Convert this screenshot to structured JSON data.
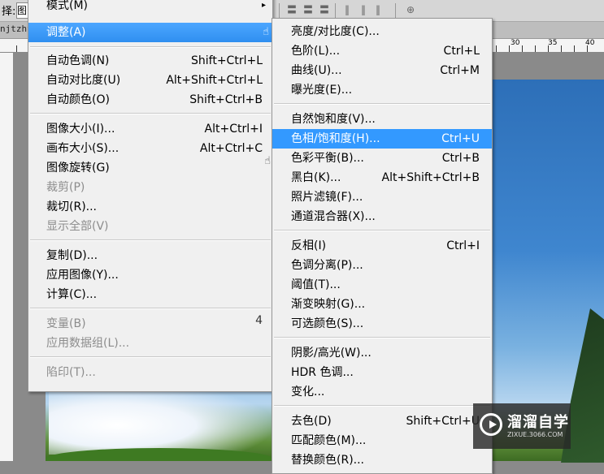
{
  "options_bar": {
    "label": "择:",
    "field_value": "图"
  },
  "doc_tab": {
    "name": "njtzhtk"
  },
  "ruler": {
    "numbers": [
      "30",
      "35",
      "40"
    ]
  },
  "main_menu": {
    "top_partial": "模式(M)",
    "highlighted": "调整(A)",
    "items": [
      {
        "label": "自动色调(N)",
        "shortcut": "Shift+Ctrl+L"
      },
      {
        "label": "自动对比度(U)",
        "shortcut": "Alt+Shift+Ctrl+L"
      },
      {
        "label": "自动颜色(O)",
        "shortcut": "Shift+Ctrl+B"
      },
      {
        "label": "图像大小(I)...",
        "shortcut": "Alt+Ctrl+I"
      },
      {
        "label": "画布大小(S)...",
        "shortcut": "Alt+Ctrl+C"
      },
      {
        "label": "图像旋转(G)",
        "shortcut": ""
      },
      {
        "label": "裁剪(P)",
        "shortcut": ""
      },
      {
        "label": "裁切(R)...",
        "shortcut": ""
      },
      {
        "label": "显示全部(V)",
        "shortcut": ""
      },
      {
        "label": "复制(D)...",
        "shortcut": ""
      },
      {
        "label": "应用图像(Y)...",
        "shortcut": ""
      },
      {
        "label": "计算(C)...",
        "shortcut": ""
      },
      {
        "label": "变量(B)",
        "shortcut": "4"
      },
      {
        "label": "应用数据组(L)...",
        "shortcut": ""
      },
      {
        "label": "陷印(T)...",
        "shortcut": ""
      }
    ]
  },
  "sub_menu": {
    "items": [
      {
        "label": "亮度/对比度(C)...",
        "shortcut": ""
      },
      {
        "label": "色阶(L)...",
        "shortcut": "Ctrl+L"
      },
      {
        "label": "曲线(U)...",
        "shortcut": "Ctrl+M"
      },
      {
        "label": "曝光度(E)...",
        "shortcut": ""
      },
      {
        "label": "自然饱和度(V)...",
        "shortcut": ""
      },
      {
        "label": "色相/饱和度(H)...",
        "shortcut": "Ctrl+U"
      },
      {
        "label": "色彩平衡(B)...",
        "shortcut": "Ctrl+B"
      },
      {
        "label": "黑白(K)...",
        "shortcut": "Alt+Shift+Ctrl+B"
      },
      {
        "label": "照片滤镜(F)...",
        "shortcut": ""
      },
      {
        "label": "通道混合器(X)...",
        "shortcut": ""
      },
      {
        "label": "反相(I)",
        "shortcut": "Ctrl+I"
      },
      {
        "label": "色调分离(P)...",
        "shortcut": ""
      },
      {
        "label": "阈值(T)...",
        "shortcut": ""
      },
      {
        "label": "渐变映射(G)...",
        "shortcut": ""
      },
      {
        "label": "可选颜色(S)...",
        "shortcut": ""
      },
      {
        "label": "阴影/高光(W)...",
        "shortcut": ""
      },
      {
        "label": "HDR 色调...",
        "shortcut": ""
      },
      {
        "label": "变化...",
        "shortcut": ""
      },
      {
        "label": "去色(D)",
        "shortcut": "Shift+Ctrl+U"
      },
      {
        "label": "匹配颜色(M)...",
        "shortcut": ""
      },
      {
        "label": "替换颜色(R)...",
        "shortcut": ""
      }
    ]
  },
  "watermark": {
    "name": "溜溜自学",
    "url": "ZIXUE.3066.COM"
  },
  "colors": {
    "highlight": "#3399ff",
    "menu_bg": "#f0f0f0",
    "disabled_text": "#8c8c8c"
  },
  "icons": [
    "hand-cursor-icon",
    "submenu-arrow-icon",
    "align-tools-icon",
    "play-logo-icon"
  ]
}
